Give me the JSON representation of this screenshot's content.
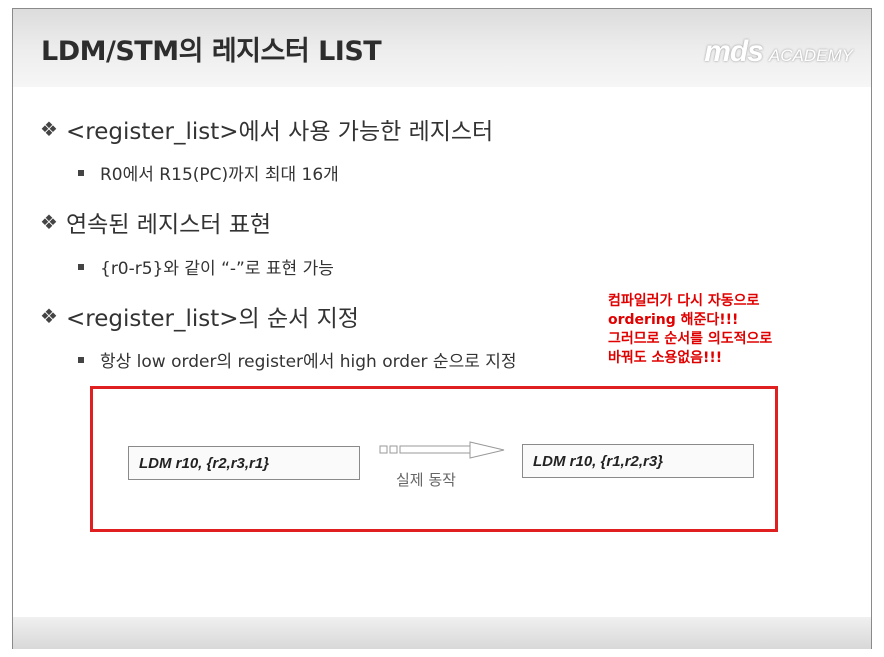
{
  "slide": {
    "title": "LDM/STM의 레지스터 LIST",
    "logo": {
      "brand": "mds",
      "sub": "ACADEMY"
    }
  },
  "bullets": [
    {
      "text": "<register_list>에서 사용 가능한 레지스터",
      "sub": "R0에서 R15(PC)까지 최대 16개"
    },
    {
      "text": "연속된 레지스터 표현",
      "sub": "{r0-r5}와 같이 “-”로 표현 가능"
    },
    {
      "text": "<register_list>의 순서 지정",
      "sub": "항상 low order의 register에서 high order 순으로 지정"
    }
  ],
  "note": {
    "lines": [
      "컴파일러가 다시 자동으로",
      "ordering 해준다!!!",
      "그러므로 순서를 의도적으로",
      "바꿔도 소용없음!!!"
    ],
    "color": "#e00000"
  },
  "diagram": {
    "left_code": "LDM r10, {r2,r3,r1}",
    "right_code": "LDM r10, {r1,r2,r3}",
    "caption": "실제 동작"
  },
  "colors": {
    "accent": "#e02020",
    "text": "#333333"
  }
}
